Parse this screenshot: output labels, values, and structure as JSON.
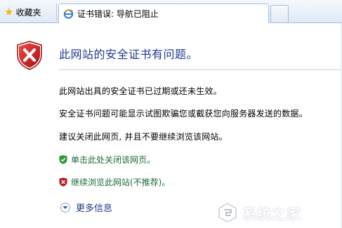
{
  "tabbar": {
    "favorites_label": "收藏夹",
    "active_tab_title": "证书错误: 导航已阻止"
  },
  "content": {
    "headline": "此网站的安全证书有问题。",
    "paragraphs": [
      "此网站出具的安全证书已过期或还未生效。",
      "安全证书问题可能显示试图欺骗您或截获您向服务器发送的数据。",
      "建议关闭此网页, 并且不要继续浏览该网站。"
    ],
    "links": {
      "close_page": "单击此处关闭该网页。",
      "continue_site": "继续浏览此网站(不推荐)。"
    },
    "more_info": "更多信息"
  },
  "watermark": {
    "text": "系统之家"
  },
  "colors": {
    "headline": "#1f3a93",
    "link_green": "#1d6a3b",
    "shield_red": "#c4171c",
    "shield_green": "#2f9a36"
  }
}
